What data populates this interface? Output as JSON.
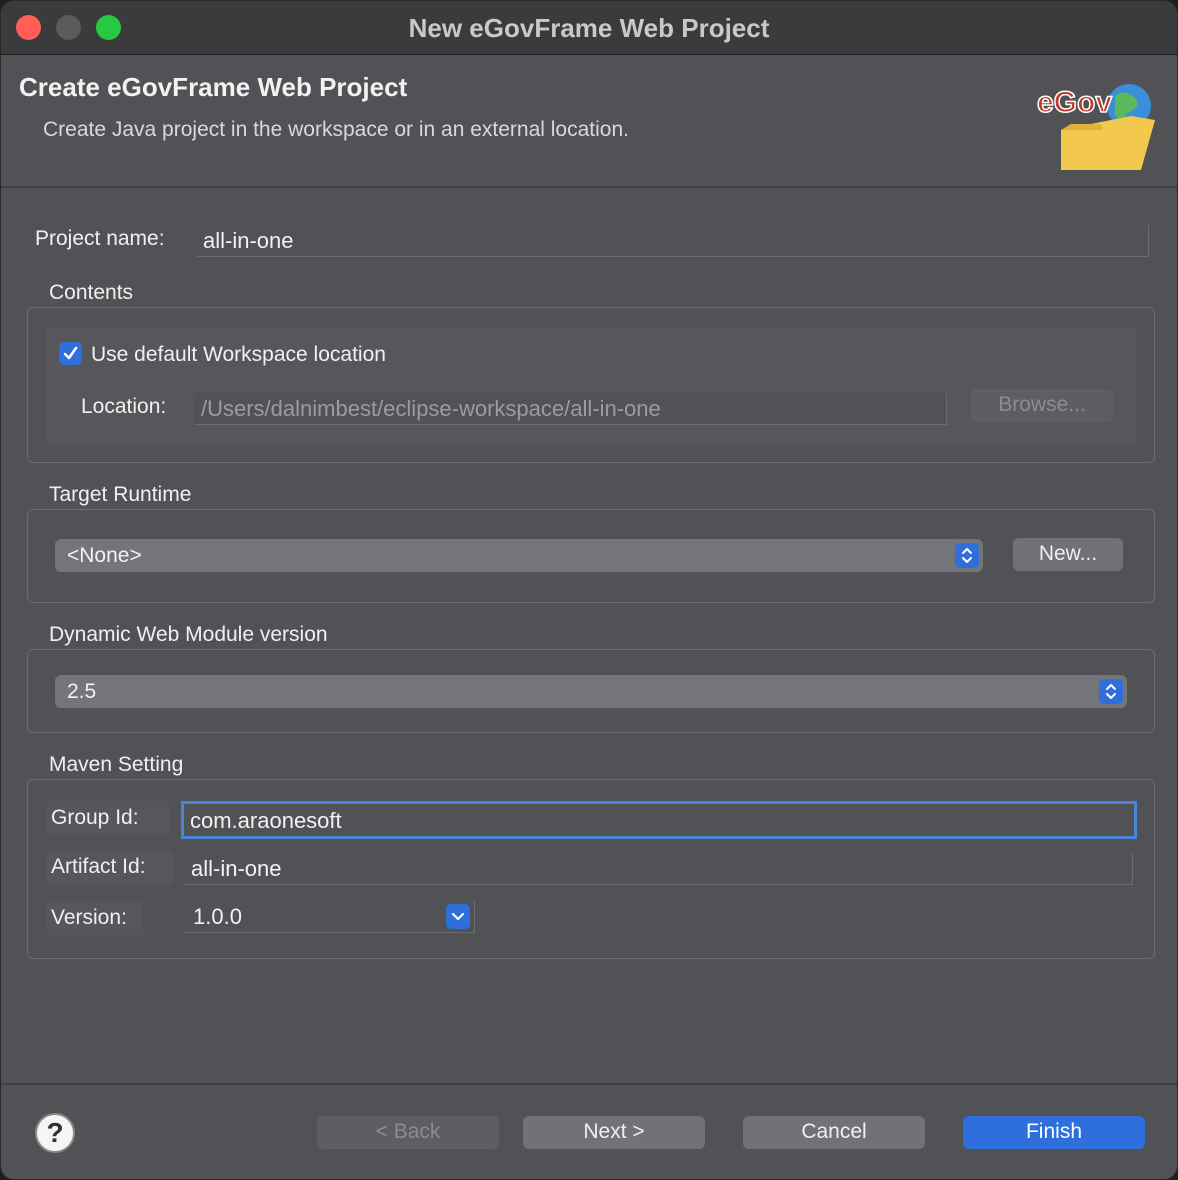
{
  "window": {
    "title": "New eGovFrame Web Project"
  },
  "header": {
    "title": "Create eGovFrame Web Project",
    "description": "Create Java project in the workspace or in an external location.",
    "logo_text": "eGov"
  },
  "project": {
    "name_label": "Project name:",
    "name_value": "all-in-one"
  },
  "contents": {
    "heading": "Contents",
    "use_default_label": "Use default Workspace location",
    "use_default_checked": true,
    "location_label": "Location:",
    "location_value": "/Users/dalnimbest/eclipse-workspace/all-in-one",
    "browse_label": "Browse..."
  },
  "target_runtime": {
    "heading": "Target Runtime",
    "selected": "<None>",
    "new_label": "New..."
  },
  "dynamic_web": {
    "heading": "Dynamic Web Module version",
    "selected": "2.5"
  },
  "maven": {
    "heading": "Maven Setting",
    "group_label": "Group Id:",
    "group_value": "com.araonesoft",
    "artifact_label": "Artifact Id:",
    "artifact_value": "all-in-one",
    "version_label": "Version:",
    "version_value": "1.0.0"
  },
  "footer": {
    "help_label": "?",
    "back_label": "< Back",
    "next_label": "Next >",
    "cancel_label": "Cancel",
    "finish_label": "Finish"
  },
  "colors": {
    "accent": "#2f6fdc",
    "close": "#ff5f57",
    "maximize": "#28c840",
    "background": "#505255"
  },
  "icons": [
    "close-icon",
    "minimize-icon",
    "maximize-icon",
    "checkmark-icon",
    "updown-chevron-icon",
    "chevron-down-icon",
    "help-icon",
    "egov-logo"
  ]
}
